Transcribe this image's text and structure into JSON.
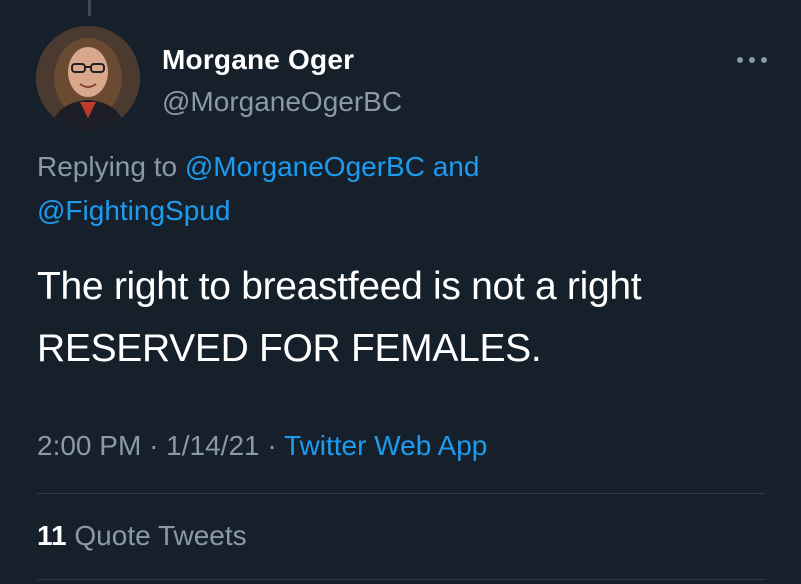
{
  "theme": {
    "background": "#16202b",
    "text_primary": "#ffffff",
    "text_secondary": "#8b98a5",
    "link": "#1d9bf0",
    "divider": "#2f3b47"
  },
  "tweet": {
    "author_name": "Morgane Oger",
    "author_handle": "@MorganeOgerBC",
    "more_icon": "more-dots-icon",
    "reply": {
      "prefix": "Replying to",
      "mention_1": "@MorganeOgerBC",
      "conjunction": "and",
      "mention_2": "@FightingSpud"
    },
    "text_line_1": "The right to breastfeed is not a right",
    "text_line_2": "RESERVED FOR FEMALES.",
    "time": "2:00 PM",
    "date": "1/14/21",
    "source": "Twitter Web App",
    "separator": "·",
    "quote_tweets": {
      "count": "11",
      "label": "Quote Tweets"
    }
  }
}
